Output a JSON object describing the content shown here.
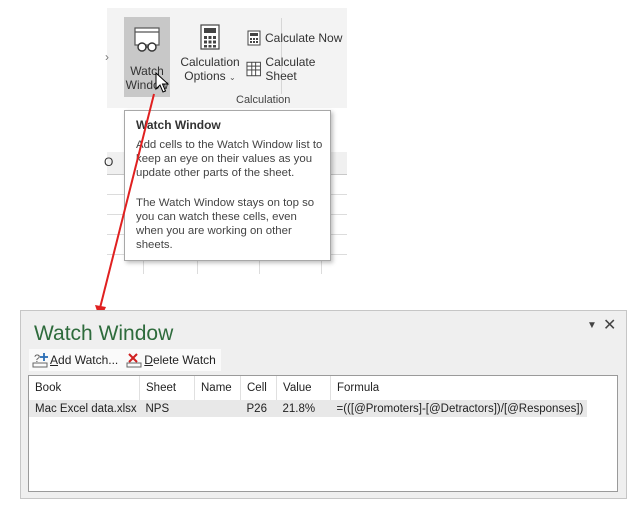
{
  "ribbon": {
    "watch_window_label_1": "Watch",
    "watch_window_label_2": "Window",
    "calc_options_label_1": "Calculation",
    "calc_options_label_2": "Options",
    "calc_options_caret": "⌄",
    "calculate_now_label": "Calculate Now",
    "calculate_sheet_label": "Calculate Sheet",
    "group_label": "Calculation",
    "partial_column_header": "O"
  },
  "tooltip": {
    "title": "Watch Window",
    "paragraph_1": "Add cells to the Watch Window list to keep an eye on their values as you update other parts of the sheet.",
    "paragraph_2": "The Watch Window stays on top so you can watch these cells, even when you are working on other sheets."
  },
  "pane": {
    "title": "Watch Window",
    "dropdown_glyph": "▼",
    "close_glyph": "✕",
    "add_watch_prefix": "A",
    "add_watch_rest": "dd Watch...",
    "delete_watch_prefix": "D",
    "delete_watch_rest": "elete Watch",
    "columns": [
      "Book",
      "Sheet",
      "Name",
      "Cell",
      "Value",
      "Formula"
    ],
    "rows": [
      {
        "book": "Mac Excel data.xlsx",
        "sheet": "NPS",
        "name": "",
        "cell": "P26",
        "value": "21.8%",
        "formula": "=(([@Promoters]-[@Detractors])/[@Responses])"
      }
    ]
  },
  "colors": {
    "pane_title": "#2e6b3c",
    "arrow": "#e02020",
    "selected_button": "#c8c8c8"
  }
}
